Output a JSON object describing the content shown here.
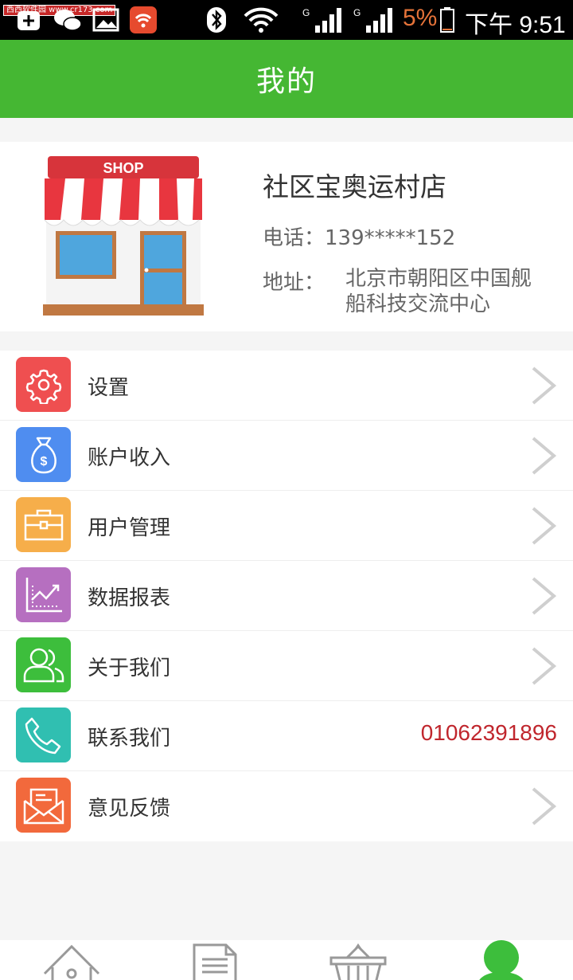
{
  "status_bar": {
    "watermark": "西西软件园 www.cr173.com",
    "battery_percent": "5%",
    "time": "下午 9:51"
  },
  "header": {
    "title": "我的"
  },
  "profile": {
    "image_text": "SHOP",
    "name": "社区宝奥运村店",
    "phone": "电话：139*****152",
    "address_label": "地址：",
    "address": "北京市朝阳区中国舰船科技交流中心"
  },
  "menu": {
    "items": [
      {
        "label": "设置",
        "icon": "gear-icon",
        "color": "#ef4f50"
      },
      {
        "label": "账户收入",
        "icon": "money-bag-icon",
        "color": "#4f8df0"
      },
      {
        "label": "用户管理",
        "icon": "toolbox-icon",
        "color": "#f6ae4a"
      },
      {
        "label": "数据报表",
        "icon": "chart-icon",
        "color": "#b66fc0"
      },
      {
        "label": "关于我们",
        "icon": "users-icon",
        "color": "#3dbe3c"
      },
      {
        "label": "联系我们",
        "icon": "phone-icon",
        "color": "#30bfb1",
        "value": "01062391896"
      },
      {
        "label": "意见反馈",
        "icon": "mail-icon",
        "color": "#f2693c"
      }
    ]
  },
  "tabbar": {
    "items": [
      {
        "icon": "home-icon"
      },
      {
        "icon": "document-icon"
      },
      {
        "icon": "basket-icon"
      },
      {
        "icon": "user-icon",
        "active_color": "#3dbe3c"
      }
    ]
  }
}
